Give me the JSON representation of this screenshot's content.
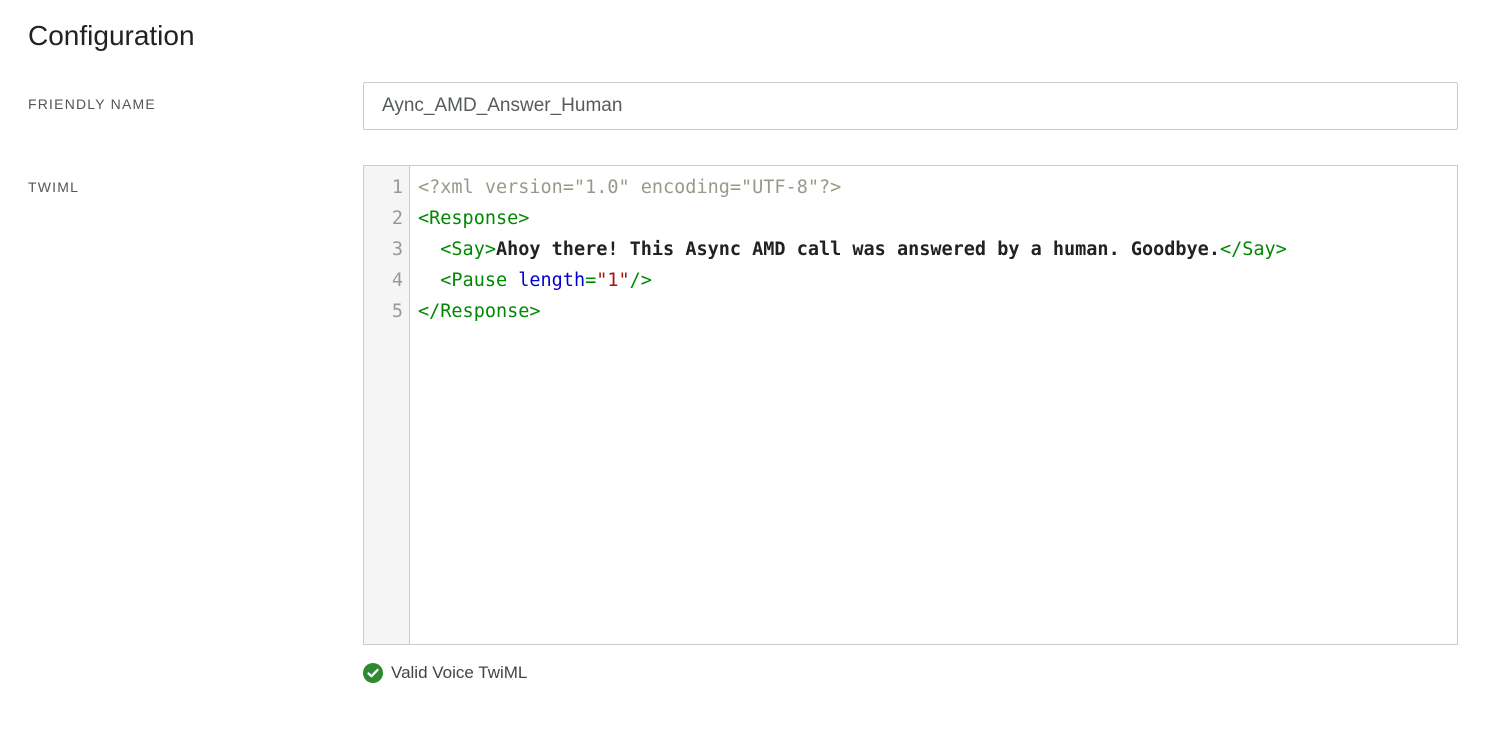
{
  "page_title": "Configuration",
  "fields": {
    "friendly_name": {
      "label": "FRIENDLY NAME",
      "value": "Aync_AMD_Answer_Human"
    },
    "twiml": {
      "label": "TWIML",
      "line_numbers": [
        "1",
        "2",
        "3",
        "4",
        "5"
      ],
      "lines": [
        {
          "type": "pi",
          "raw": "<?xml version=\"1.0\" encoding=\"UTF-8\"?>"
        },
        {
          "type": "open",
          "tag": "Response",
          "indent": 0
        },
        {
          "type": "element_text",
          "indent": 1,
          "tag": "Say",
          "text": "Ahoy there! This Async AMD call was answered by a human. Goodbye."
        },
        {
          "type": "self_close_attr",
          "indent": 1,
          "tag": "Pause",
          "attr": "length",
          "val": "\"1\""
        },
        {
          "type": "close",
          "tag": "Response",
          "indent": 0
        }
      ],
      "validation_text": "Valid Voice TwiML"
    }
  },
  "colors": {
    "check_green": "#2f8a2f"
  }
}
